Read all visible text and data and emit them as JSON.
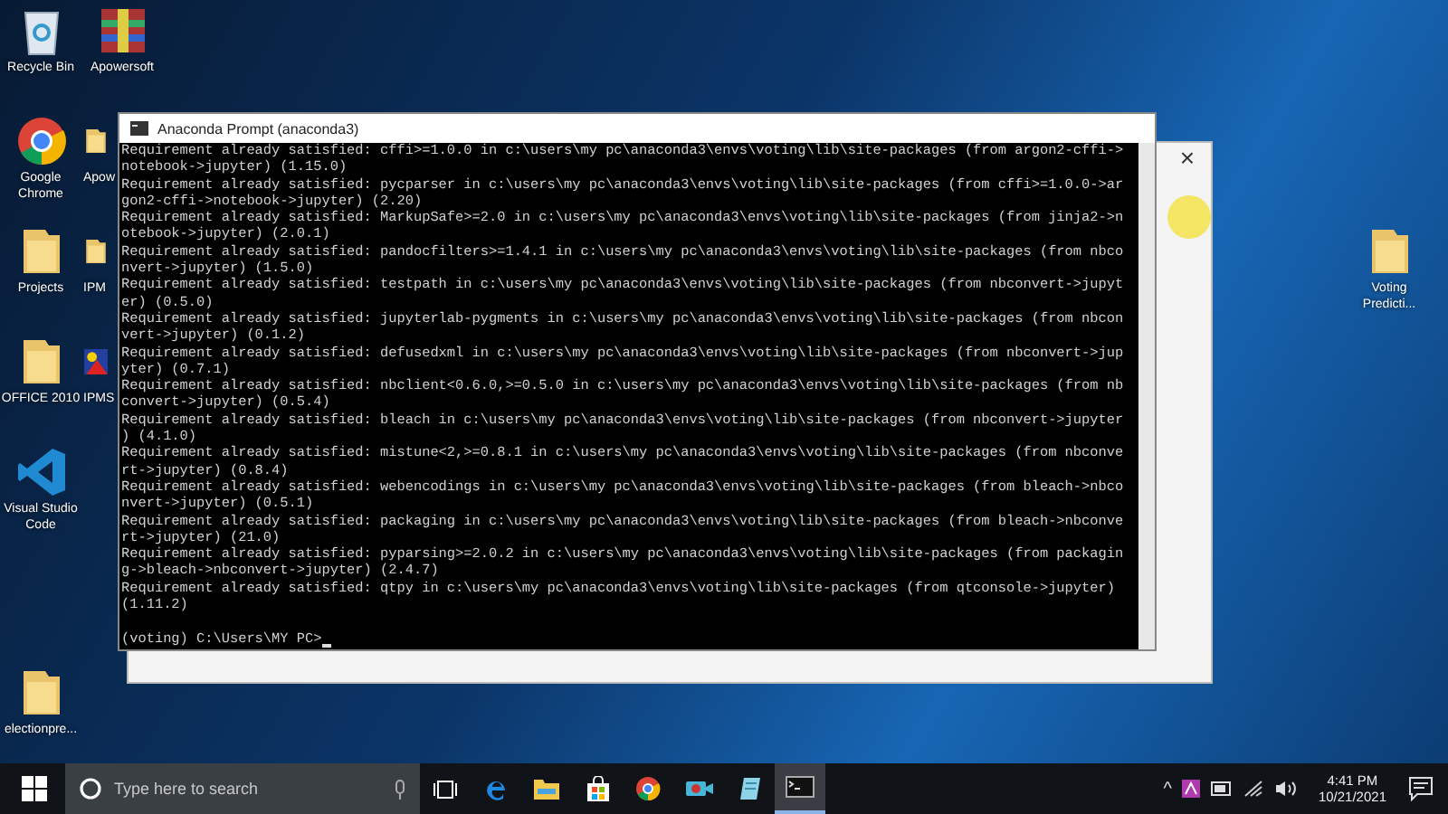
{
  "desktop_icons": [
    {
      "label": "Recycle Bin",
      "kind": "recycle"
    },
    {
      "label": "Apowersoft",
      "kind": "archive"
    },
    {
      "label": "Google Chrome",
      "kind": "chrome"
    },
    {
      "label": "Apow",
      "kind": "folder"
    },
    {
      "label": "Projects",
      "kind": "folder"
    },
    {
      "label": "IPM",
      "kind": "folder"
    },
    {
      "label": "OFFICE 2010",
      "kind": "folder"
    },
    {
      "label": "IPMS",
      "kind": "app"
    },
    {
      "label": "Visual Studio Code",
      "kind": "vscode"
    },
    {
      "label": "electionpre...",
      "kind": "folder"
    },
    {
      "label": "Voting Predicti...",
      "kind": "folder"
    }
  ],
  "terminal": {
    "title": "Anaconda Prompt (anaconda3)",
    "lines": [
      "Requirement already satisfied: cffi>=1.0.0 in c:\\users\\my pc\\anaconda3\\envs\\voting\\lib\\site-packages (from argon2-cffi->",
      "notebook->jupyter) (1.15.0)",
      "Requirement already satisfied: pycparser in c:\\users\\my pc\\anaconda3\\envs\\voting\\lib\\site-packages (from cffi>=1.0.0->ar",
      "gon2-cffi->notebook->jupyter) (2.20)",
      "Requirement already satisfied: MarkupSafe>=2.0 in c:\\users\\my pc\\anaconda3\\envs\\voting\\lib\\site-packages (from jinja2->n",
      "otebook->jupyter) (2.0.1)",
      "Requirement already satisfied: pandocfilters>=1.4.1 in c:\\users\\my pc\\anaconda3\\envs\\voting\\lib\\site-packages (from nbco",
      "nvert->jupyter) (1.5.0)",
      "Requirement already satisfied: testpath in c:\\users\\my pc\\anaconda3\\envs\\voting\\lib\\site-packages (from nbconvert->jupyt",
      "er) (0.5.0)",
      "Requirement already satisfied: jupyterlab-pygments in c:\\users\\my pc\\anaconda3\\envs\\voting\\lib\\site-packages (from nbcon",
      "vert->jupyter) (0.1.2)",
      "Requirement already satisfied: defusedxml in c:\\users\\my pc\\anaconda3\\envs\\voting\\lib\\site-packages (from nbconvert->jup",
      "yter) (0.7.1)",
      "Requirement already satisfied: nbclient<0.6.0,>=0.5.0 in c:\\users\\my pc\\anaconda3\\envs\\voting\\lib\\site-packages (from nb",
      "convert->jupyter) (0.5.4)",
      "Requirement already satisfied: bleach in c:\\users\\my pc\\anaconda3\\envs\\voting\\lib\\site-packages (from nbconvert->jupyter",
      ") (4.1.0)",
      "Requirement already satisfied: mistune<2,>=0.8.1 in c:\\users\\my pc\\anaconda3\\envs\\voting\\lib\\site-packages (from nbconve",
      "rt->jupyter) (0.8.4)",
      "Requirement already satisfied: webencodings in c:\\users\\my pc\\anaconda3\\envs\\voting\\lib\\site-packages (from bleach->nbco",
      "nvert->jupyter) (0.5.1)",
      "Requirement already satisfied: packaging in c:\\users\\my pc\\anaconda3\\envs\\voting\\lib\\site-packages (from bleach->nbconve",
      "rt->jupyter) (21.0)",
      "Requirement already satisfied: pyparsing>=2.0.2 in c:\\users\\my pc\\anaconda3\\envs\\voting\\lib\\site-packages (from packagin",
      "g->bleach->nbconvert->jupyter) (2.4.7)",
      "Requirement already satisfied: qtpy in c:\\users\\my pc\\anaconda3\\envs\\voting\\lib\\site-packages (from qtconsole->jupyter)",
      "(1.11.2)"
    ],
    "prompt": "(voting) C:\\Users\\MY PC>"
  },
  "back_window": {
    "close": "×"
  },
  "taskbar": {
    "search": {
      "placeholder": "Type here to search"
    },
    "apps": [
      {
        "kind": "taskview",
        "selected": false
      },
      {
        "kind": "edge",
        "selected": false
      },
      {
        "kind": "explorer",
        "selected": false
      },
      {
        "kind": "store",
        "selected": false
      },
      {
        "kind": "chrome",
        "selected": false
      },
      {
        "kind": "camera",
        "selected": false
      },
      {
        "kind": "notes",
        "selected": false
      },
      {
        "kind": "terminal",
        "selected": true
      }
    ],
    "tray": {
      "chevron": "^",
      "time": "4:41 PM",
      "date": "10/21/2021"
    }
  }
}
